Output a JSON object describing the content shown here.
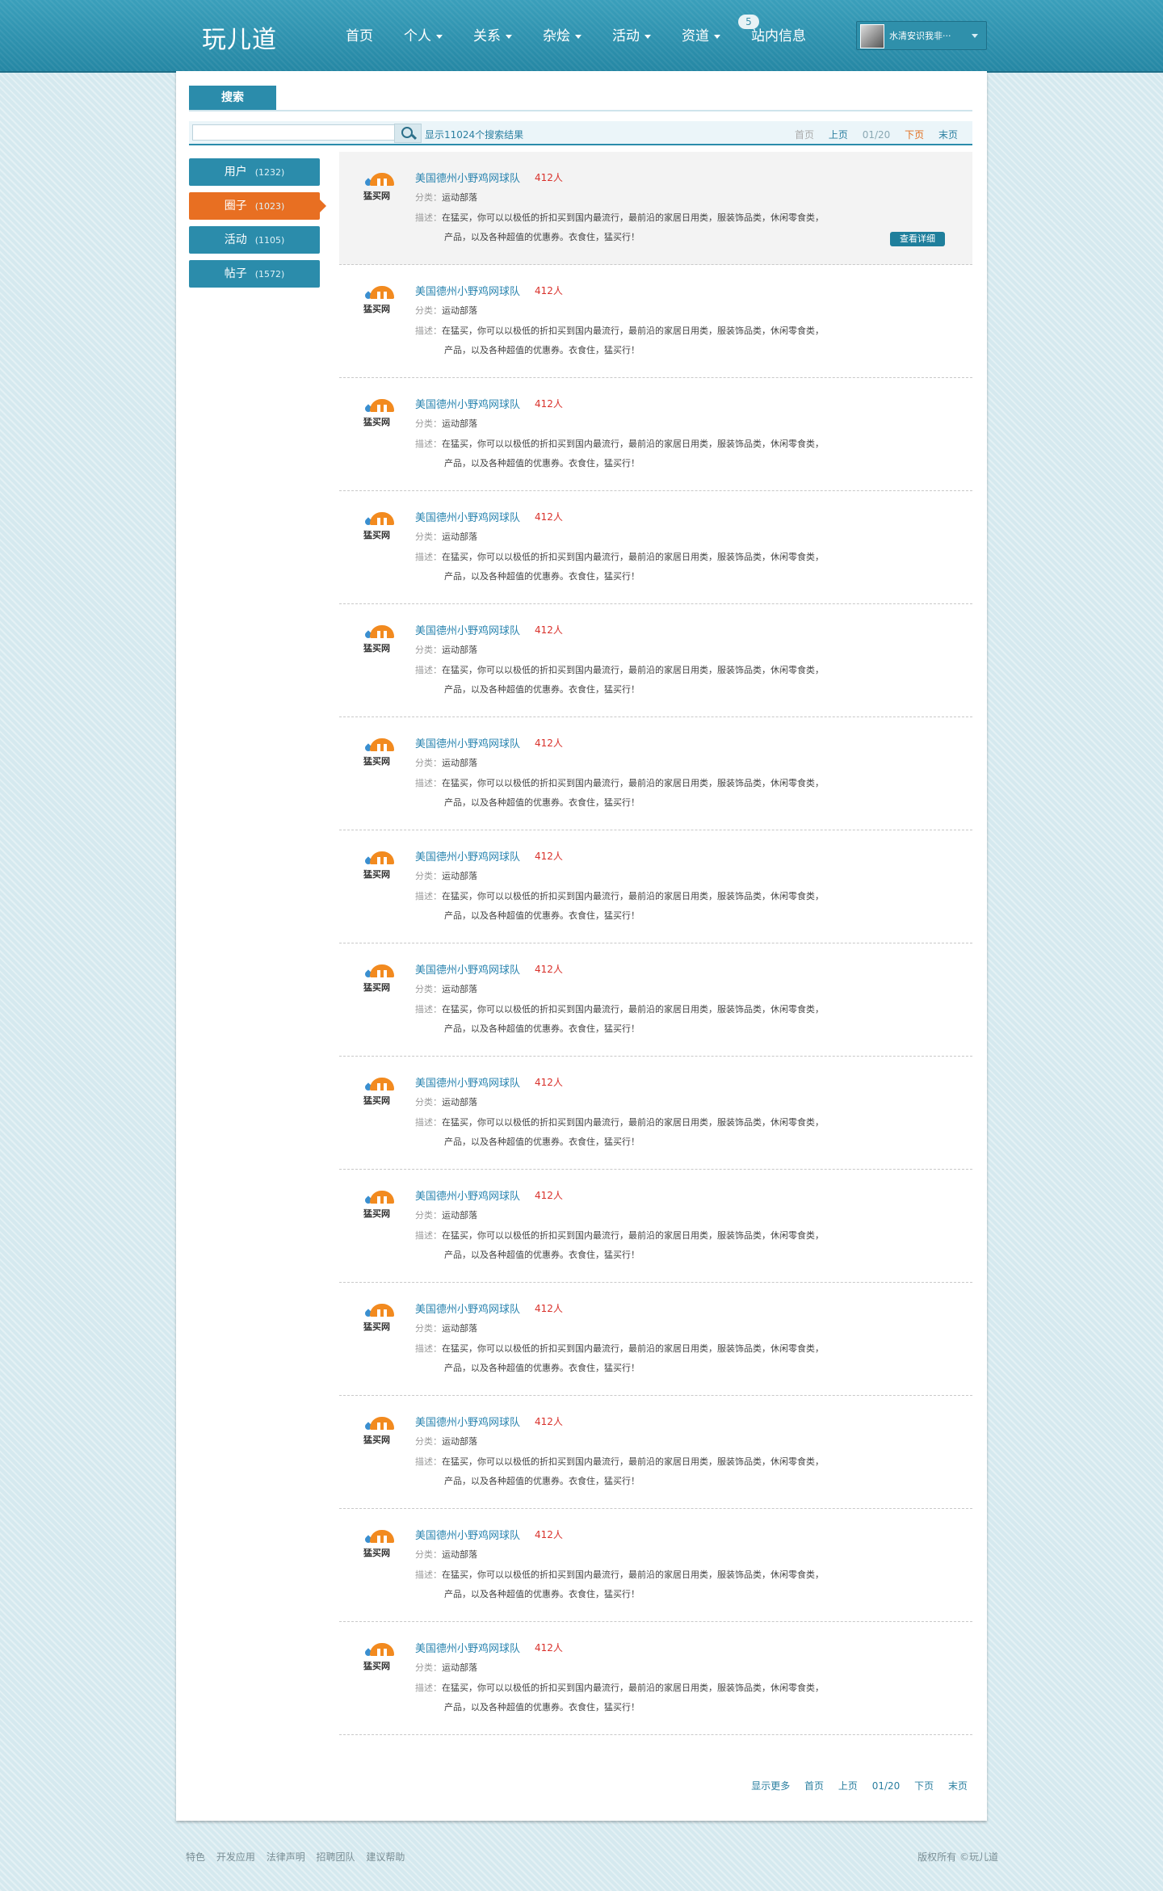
{
  "header": {
    "logo": "玩儿道",
    "nav": [
      {
        "label": "首页",
        "dropdown": false
      },
      {
        "label": "个人",
        "dropdown": true
      },
      {
        "label": "关系",
        "dropdown": true
      },
      {
        "label": "杂烩",
        "dropdown": true
      },
      {
        "label": "活动",
        "dropdown": true
      },
      {
        "label": "资道",
        "dropdown": true
      },
      {
        "label": "站内信息",
        "dropdown": false
      }
    ],
    "message_badge": "5",
    "user_name": "水清安识我非···"
  },
  "search": {
    "tab_label": "搜索",
    "input_value": "",
    "input_placeholder": "",
    "result_count": "显示11024个搜索结果"
  },
  "pager": {
    "first": "首页",
    "prev": "上页",
    "current": "01/20",
    "next": "下页",
    "last": "末页",
    "show_more": "显示更多"
  },
  "categories": [
    {
      "label": "用户",
      "count": "(1232)",
      "active": false
    },
    {
      "label": "圈子",
      "count": "(1023)",
      "active": true
    },
    {
      "label": "活动",
      "count": "(1105)",
      "active": false
    },
    {
      "label": "帖子",
      "count": "(1572)",
      "active": false
    }
  ],
  "result_item": {
    "brand": "猛买网",
    "title": "美国德州小野鸡网球队",
    "members": "412人",
    "category_label": "分类：",
    "category_value": "运动部落",
    "desc_label": "描述：",
    "desc_line1": "在猛买，你可以以极低的折扣买到国内最流行，最前沿的家居日用类，服装饰品类，休闲零食类，",
    "desc_line2": "产品，以及各种超值的优惠券。衣食住，猛买行！",
    "detail_button": "查看详细"
  },
  "results_count_shown": 14,
  "colors": {
    "topbar": "#2b8eaa",
    "accent": "#2b8cab",
    "active_tab": "#e86f22",
    "members_red": "#d9312b",
    "background": "#d5e9ef"
  },
  "footer": {
    "links": [
      "特色",
      "开发应用",
      "法律声明",
      "招聘团队",
      "建议帮助"
    ],
    "copyright": "版权所有 ©玩儿道"
  }
}
